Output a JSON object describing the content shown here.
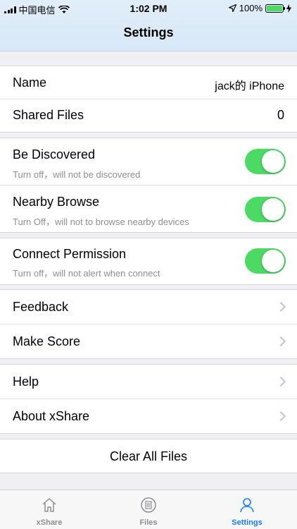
{
  "status_bar": {
    "carrier": "中国电信",
    "time": "1:02 PM",
    "battery": "100%"
  },
  "header": {
    "title": "Settings"
  },
  "sections": {
    "info": {
      "name_label": "Name",
      "name_value": "jack的 iPhone",
      "shared_label": "Shared Files",
      "shared_value": "0"
    },
    "discover": {
      "be_discovered_title": "Be Discovered",
      "be_discovered_sub": "Turn off，will not be discovered",
      "nearby_title": "Nearby Browse",
      "nearby_sub": "Turn Off，will not to browse nearby devices"
    },
    "permission": {
      "title": "Connect Permission",
      "sub": "Turn off，will not alert when connect"
    },
    "feedback": {
      "feedback_label": "Feedback",
      "score_label": "Make Score"
    },
    "about": {
      "help_label": "Help",
      "about_label": "About xShare"
    },
    "clear": {
      "label": "Clear All Files"
    }
  },
  "tabbar": {
    "tabs": [
      {
        "label": "xShare",
        "icon": "home-icon",
        "active": false
      },
      {
        "label": "Files",
        "icon": "files-icon",
        "active": false
      },
      {
        "label": "Settings",
        "icon": "person-icon",
        "active": true
      }
    ]
  },
  "colors": {
    "accent": "#1a7cf5",
    "toggle_on": "#4cd964",
    "inactive_tab": "#8e8e93"
  }
}
